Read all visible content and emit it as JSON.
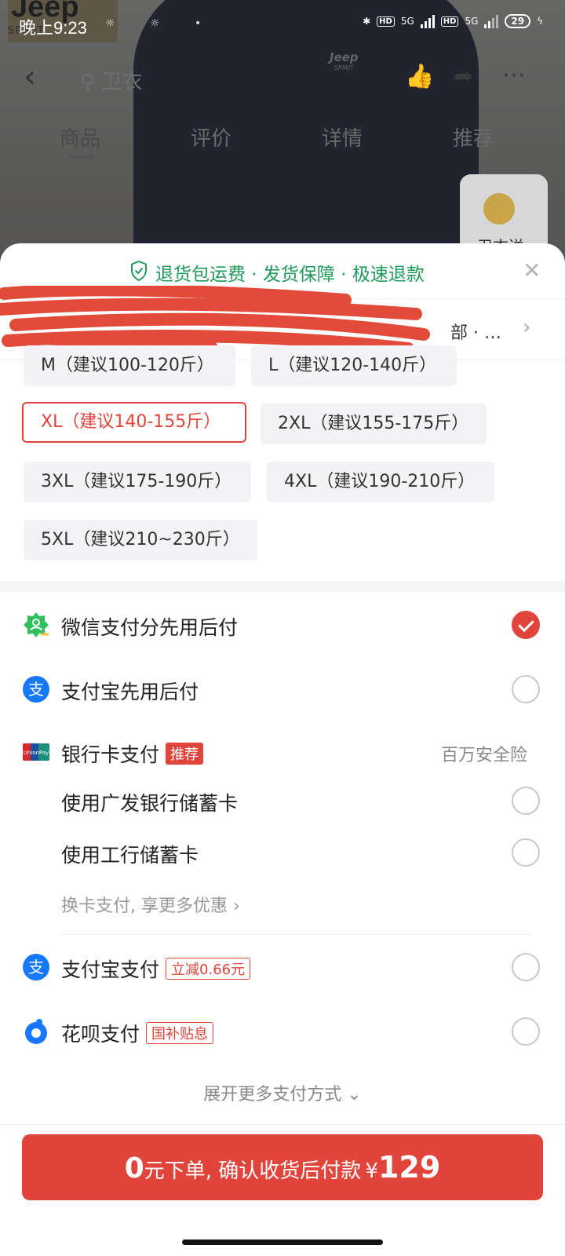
{
  "status_bar": {
    "time": "晚上9:23",
    "hd1": "HD",
    "net1": "5G",
    "hd2": "HD",
    "net2": "5G",
    "battery": "29"
  },
  "background": {
    "brand": "Jeep",
    "brand_sub": "SPIRIT",
    "shirt_logo": "Jeep",
    "shirt_logo_sub": "SPIRIT",
    "search_placeholder": "卫衣",
    "tabs": [
      "商品",
      "评价",
      "详情",
      "推荐"
    ],
    "active_tab": "商品",
    "service_label": "卫衣送"
  },
  "sheet": {
    "guarantee": "退货包运费 · 发货保障 · 极速退款",
    "address_text": "部 · …",
    "sizes": [
      {
        "label": "M（建议100-120斤）",
        "selected": false
      },
      {
        "label": "L（建议120-140斤）",
        "selected": false
      },
      {
        "label": "XL（建议140-155斤）",
        "selected": true
      },
      {
        "label": "2XL（建议155-175斤）",
        "selected": false
      },
      {
        "label": "3XL（建议175-190斤）",
        "selected": false
      },
      {
        "label": "4XL（建议190-210斤）",
        "selected": false
      },
      {
        "label": "5XL（建议210~230斤）",
        "selected": false
      }
    ],
    "payments": {
      "wechat": {
        "label": "微信支付分先用后付",
        "selected": true
      },
      "alipay_later": {
        "label": "支付宝先用后付",
        "selected": false
      },
      "bank": {
        "label": "银行卡支付",
        "badge": "推荐",
        "note": "百万安全险"
      },
      "bank_cards": [
        {
          "label": "使用广发银行储蓄卡",
          "selected": false
        },
        {
          "label": "使用工行储蓄卡",
          "selected": false
        }
      ],
      "switch_card": "换卡支付, 享更多优惠",
      "alipay": {
        "label": "支付宝支付",
        "badge": "立减0.66元",
        "selected": false
      },
      "huabei": {
        "label": "花呗支付",
        "badge": "国补贴息",
        "selected": false
      },
      "expand": "展开更多支付方式"
    }
  },
  "footer": {
    "order_big": "0",
    "order_text": "元下单, 确认收货后付款",
    "currency": "¥",
    "price": "129"
  },
  "colors": {
    "accent": "#e0443a",
    "guarantee_green": "#1f9a5a",
    "wechat_green": "#2fbf5c",
    "alipay_blue": "#1677ff"
  }
}
